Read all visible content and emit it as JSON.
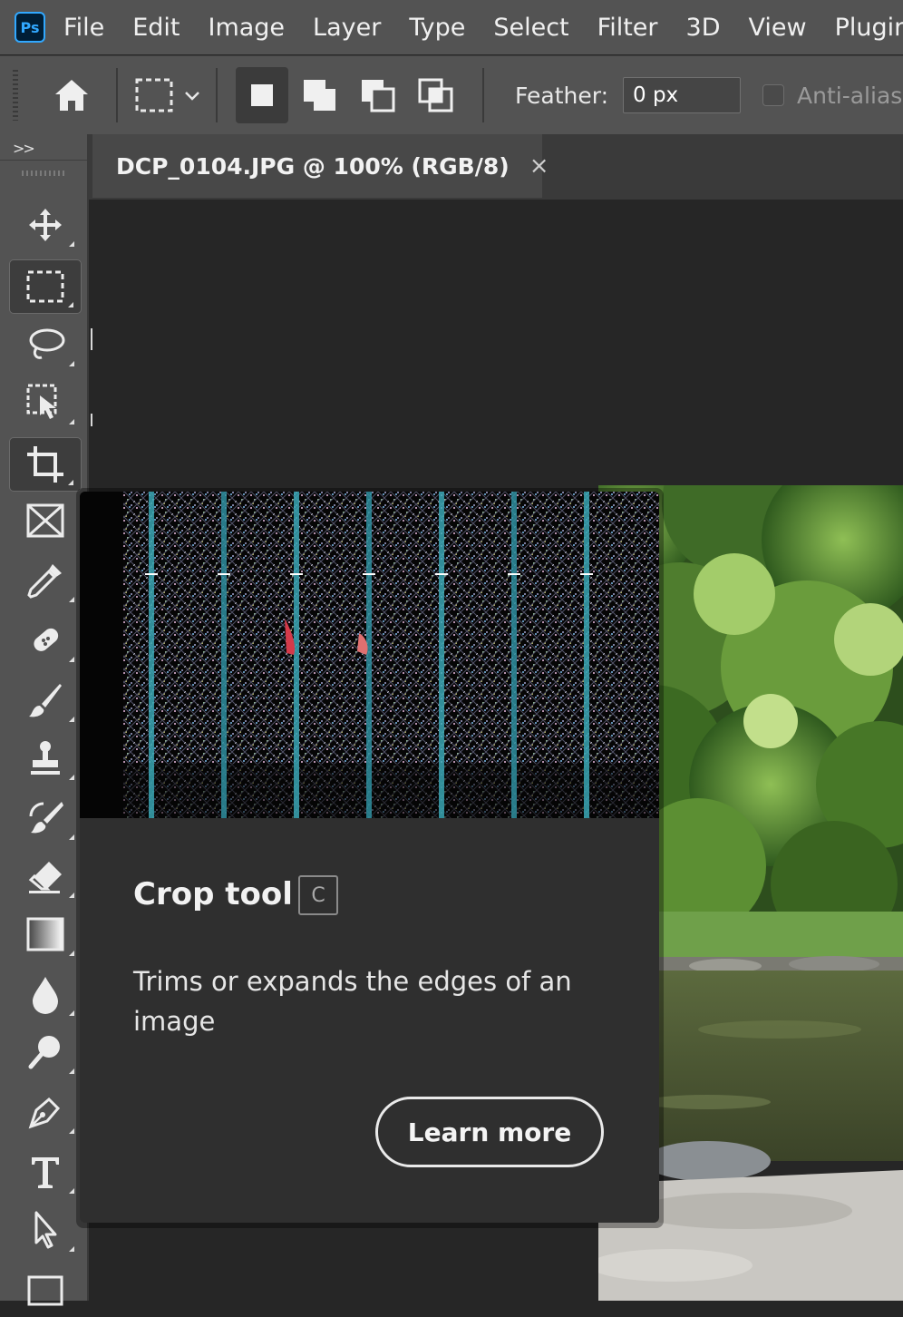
{
  "app": {
    "logo_text": "Ps"
  },
  "menu": [
    "File",
    "Edit",
    "Image",
    "Layer",
    "Type",
    "Select",
    "Filter",
    "3D",
    "View",
    "Plugins"
  ],
  "options_bar": {
    "feather_label": "Feather:",
    "feather_value": "0 px",
    "anti_alias_label": "Anti-alias",
    "anti_alias_checked": false
  },
  "tools_panel": {
    "collapse_glyph": ">>",
    "tools": [
      {
        "name": "move",
        "selected": false
      },
      {
        "name": "rectangular-marquee",
        "selected": true
      },
      {
        "name": "lasso",
        "selected": false
      },
      {
        "name": "object-selection",
        "selected": false
      },
      {
        "name": "crop",
        "selected": true
      },
      {
        "name": "frame",
        "selected": false
      },
      {
        "name": "eyedropper",
        "selected": false
      },
      {
        "name": "spot-healing-brush",
        "selected": false
      },
      {
        "name": "brush",
        "selected": false
      },
      {
        "name": "clone-stamp",
        "selected": false
      },
      {
        "name": "history-brush",
        "selected": false
      },
      {
        "name": "eraser",
        "selected": false
      },
      {
        "name": "gradient",
        "selected": false
      },
      {
        "name": "blur",
        "selected": false
      },
      {
        "name": "dodge",
        "selected": false
      },
      {
        "name": "pen",
        "selected": false
      },
      {
        "name": "type",
        "selected": false
      },
      {
        "name": "path-selection",
        "selected": false
      },
      {
        "name": "rectangle",
        "selected": false
      }
    ]
  },
  "document_tab": {
    "title": "DCP_0104.JPG @ 100% (RGB/8)",
    "close_glyph": "×"
  },
  "tooltip": {
    "title": "Crop tool",
    "shortcut": "C",
    "description": "Trims or expands the edges of an image",
    "learn_more_label": "Learn more"
  },
  "colors": {
    "ui_panel": "#535353",
    "canvas_bg": "#262626",
    "tooltip_bg": "#2f2f2f",
    "ps_blue": "#31a8ff"
  }
}
